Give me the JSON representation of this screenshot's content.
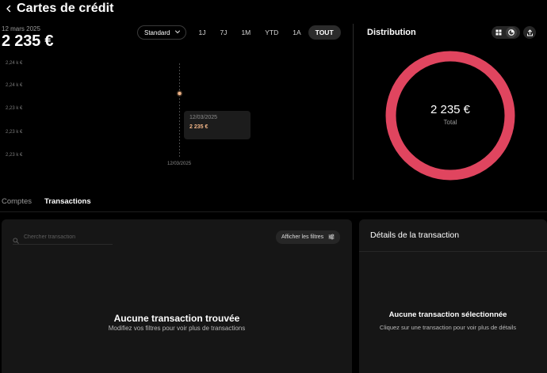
{
  "header": {
    "title": "Cartes de crédit"
  },
  "summary": {
    "date": "12 mars 2025",
    "value": "2 235 €"
  },
  "controls": {
    "mode_label": "Standard",
    "ranges": [
      "1J",
      "7J",
      "1M",
      "YTD",
      "1A",
      "TOUT"
    ],
    "active_range": "TOUT"
  },
  "chart": {
    "y_ticks": [
      "2,24 k €",
      "2,24 k €",
      "2,23 k €",
      "2,23 k €",
      "2,23 k €"
    ],
    "x_tick": "12/03/2025",
    "tooltip_date": "12/03/2025",
    "tooltip_value": "2 235 €"
  },
  "chart_data": {
    "type": "line",
    "x": [
      "12/03/2025"
    ],
    "series": [
      {
        "values": [
          2235
        ]
      }
    ],
    "y_tick_labels": [
      "2,24 k €",
      "2,24 k €",
      "2,23 k €",
      "2,23 k €",
      "2,23 k €"
    ],
    "grid": false,
    "point_color": "#f0b487"
  },
  "distribution": {
    "title": "Distribution",
    "total_value": "2 235 €",
    "total_label": "Total",
    "ring_color": "#e0455f"
  },
  "tabs": [
    "Comptes",
    "Transactions"
  ],
  "active_tab": "Transactions",
  "transactions": {
    "search_placeholder": "Chercher transaction",
    "filters_label": "Afficher les filtres",
    "empty_title": "Aucune transaction trouvée",
    "empty_subtitle": "Modifiez vos filtres pour voir plus de transactions"
  },
  "details": {
    "title": "Détails de la transaction",
    "empty_title": "Aucune transaction sélectionnée",
    "empty_subtitle": "Cliquez sur une transaction pour voir plus de détails"
  },
  "colors": {
    "accent": "#f0b487",
    "background": "#000000",
    "panel": "#161616"
  },
  "icons": [
    "back-icon",
    "chevron-down-icon",
    "grid-icon",
    "pie-icon",
    "share-icon",
    "search-icon",
    "sliders-icon"
  ]
}
